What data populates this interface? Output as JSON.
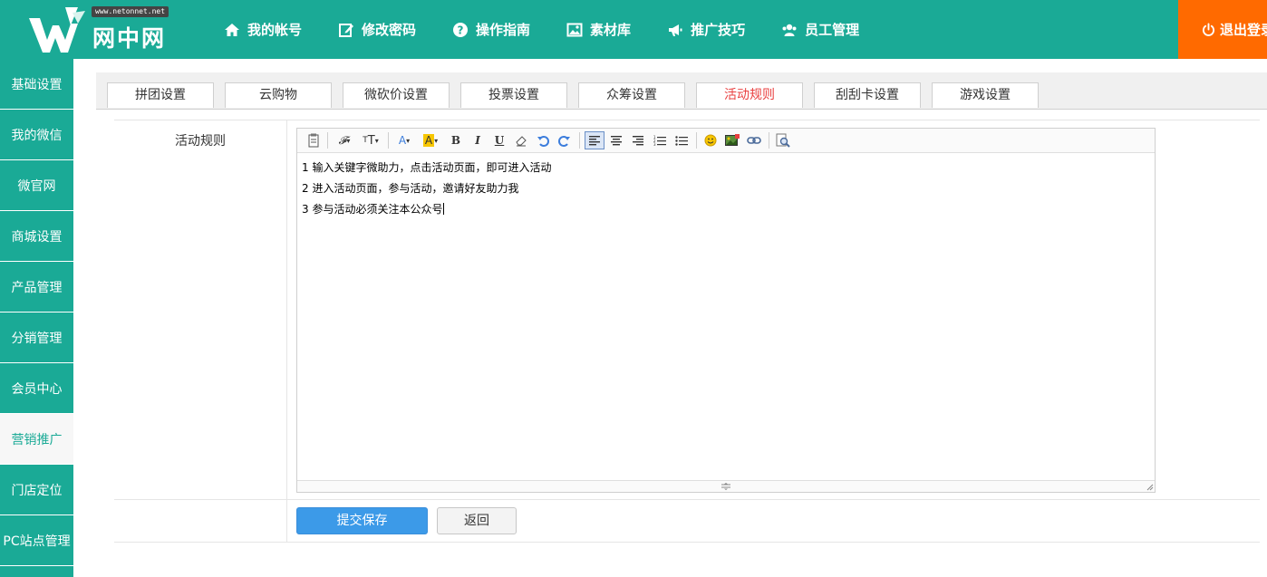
{
  "header": {
    "logo": {
      "tagline": "www.netonnet.net",
      "brand": "网中网"
    },
    "nav": [
      {
        "label": "我的帐号",
        "icon": "home-icon"
      },
      {
        "label": "修改密码",
        "icon": "edit-icon"
      },
      {
        "label": "操作指南",
        "icon": "help-icon"
      },
      {
        "label": "素材库",
        "icon": "image-icon"
      },
      {
        "label": "推广技巧",
        "icon": "megaphone-icon"
      },
      {
        "label": "员工管理",
        "icon": "users-icon"
      }
    ],
    "logout": {
      "label": "退出登录",
      "icon": "power-icon"
    }
  },
  "sidebar": {
    "items": [
      {
        "label": "基础设置"
      },
      {
        "label": "我的微信"
      },
      {
        "label": "微官网"
      },
      {
        "label": "商城设置"
      },
      {
        "label": "产品管理"
      },
      {
        "label": "分销管理"
      },
      {
        "label": "会员中心"
      },
      {
        "label": "营销推广",
        "active": true
      },
      {
        "label": "门店定位"
      },
      {
        "label": "PC站点管理"
      }
    ]
  },
  "tabs": [
    {
      "label": "拼团设置"
    },
    {
      "label": "云购物"
    },
    {
      "label": "微砍价设置"
    },
    {
      "label": "投票设置"
    },
    {
      "label": "众筹设置"
    },
    {
      "label": "活动规则",
      "active": true
    },
    {
      "label": "刮刮卡设置"
    },
    {
      "label": "游戏设置"
    }
  ],
  "form": {
    "field_label": "活动规则",
    "editor": {
      "toolbar": [
        "source-icon",
        "font-family-icon",
        "font-size-icon",
        "font-color-icon",
        "highlight-color-icon",
        "bold-icon",
        "italic-icon",
        "underline-icon",
        "eraser-icon",
        "undo-icon",
        "redo-icon",
        "align-left-icon",
        "align-center-icon",
        "align-right-icon",
        "ordered-list-icon",
        "unordered-list-icon",
        "emoticon-icon",
        "insert-image-icon",
        "link-icon",
        "preview-icon"
      ],
      "content": [
        "1 输入关键字微助力，点击活动页面，即可进入活动",
        "2 进入活动页面，参与活动，邀请好友助力我",
        "3 参与活动必须关注本公众号"
      ]
    },
    "submit_label": "提交保存",
    "back_label": "返回"
  },
  "colors": {
    "primary": "#1aaa96",
    "logout": "#ff6a00",
    "active_tab": "#e94040",
    "button": "#3c9ae8"
  }
}
